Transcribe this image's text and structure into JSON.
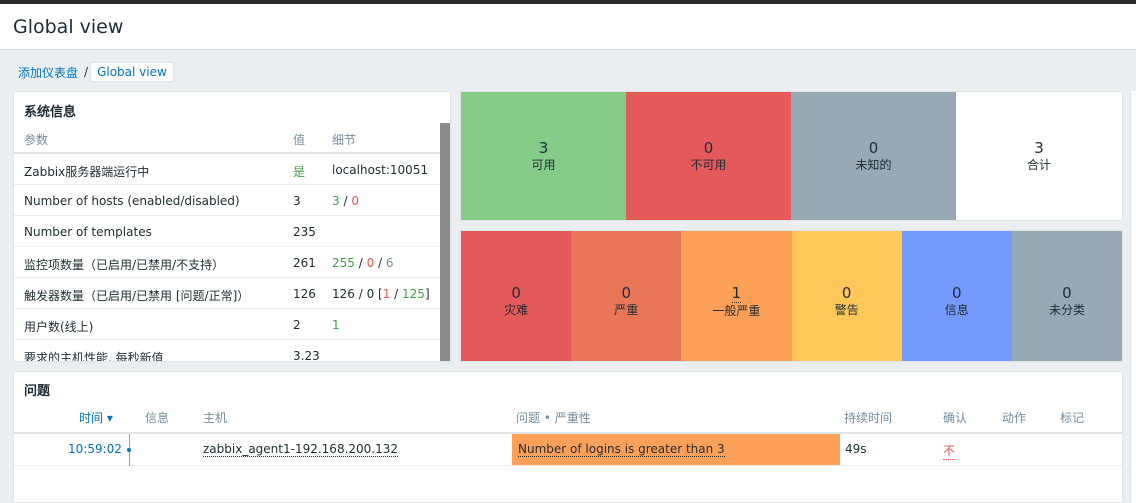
{
  "page": {
    "title": "Global view"
  },
  "breadcrumb": {
    "parent": "添加仪表盘",
    "separator": "/",
    "current": "Global view"
  },
  "system_info": {
    "title": "系统信息",
    "headers": {
      "param": "参数",
      "value": "值",
      "details": "细节"
    },
    "rows": [
      {
        "param": "Zabbix服务器端运行中",
        "value": "是",
        "details": "localhost:10051"
      },
      {
        "param": "Number of hosts (enabled/disabled)",
        "value": "3",
        "d1": "3",
        "sep1": " / ",
        "d2": "0"
      },
      {
        "param": "Number of templates",
        "value": "235"
      },
      {
        "param": "监控项数量（已启用/已禁用/不支持）",
        "value": "261",
        "d1": "255",
        "sep1": " / ",
        "d2": "0",
        "sep2": " / ",
        "d3": "6"
      },
      {
        "param": "触发器数量（已启用/已禁用 [问题/正常]）",
        "value": "126",
        "d0": "126 / 0 [",
        "d1": "1",
        "sep1": " / ",
        "d2": "125",
        "end": "]"
      },
      {
        "param": "用户数(线上)",
        "value": "2",
        "details": "1"
      },
      {
        "param": "要求的主机性能, 每秒新值",
        "value": "3.23"
      }
    ]
  },
  "host_availability": [
    {
      "count": "3",
      "label": "可用",
      "color": "#86cc89"
    },
    {
      "count": "0",
      "label": "不可用",
      "color": "#e45959"
    },
    {
      "count": "0",
      "label": "未知的",
      "color": "#97aab3"
    },
    {
      "count": "3",
      "label": "合计",
      "color": "#ffffff"
    }
  ],
  "severity": [
    {
      "count": "0",
      "label": "灾难",
      "color": "#e45959"
    },
    {
      "count": "0",
      "label": "严重",
      "color": "#e97659"
    },
    {
      "count": "1",
      "label": "一般严重",
      "color": "#ffa059"
    },
    {
      "count": "0",
      "label": "警告",
      "color": "#ffc859"
    },
    {
      "count": "0",
      "label": "信息",
      "color": "#7499ff"
    },
    {
      "count": "0",
      "label": "未分类",
      "color": "#97aab3"
    }
  ],
  "problems": {
    "title": "问题",
    "headers": {
      "time": "时间 ▾",
      "info": "信息",
      "host": "主机",
      "problem": "问题 • 严重性",
      "duration": "持续时间",
      "ack": "确认",
      "actions": "动作",
      "tags": "标记"
    },
    "rows": [
      {
        "time": "10:59:02",
        "host": "zabbix_agent1-192.168.200.132",
        "problem": "Number of logins is greater than 3",
        "duration": "49s",
        "ack": "不"
      }
    ]
  }
}
